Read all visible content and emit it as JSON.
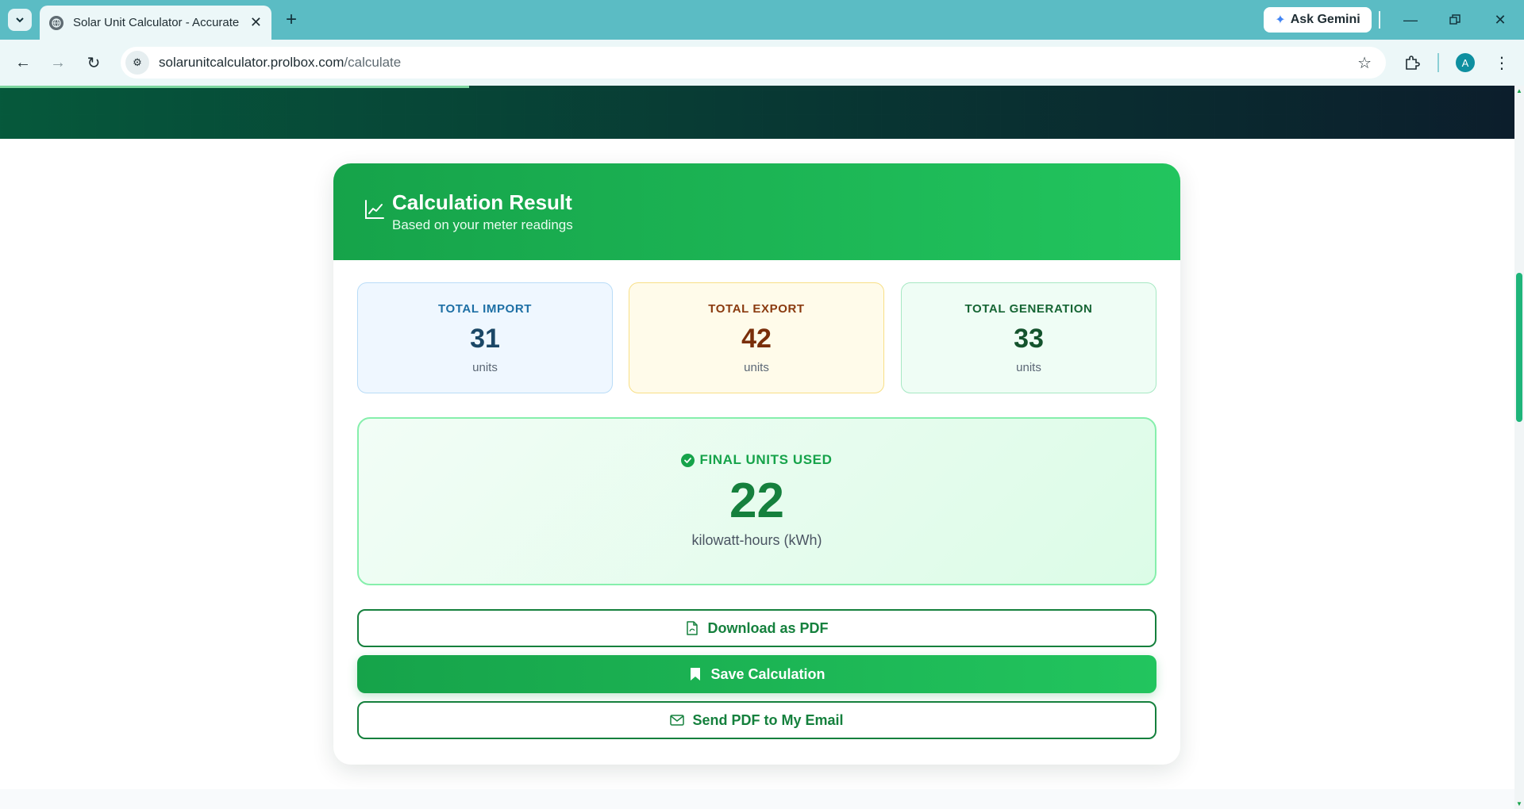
{
  "browser": {
    "tab_title": "Solar Unit Calculator - Accurate",
    "ask_gemini": "Ask Gemini",
    "url_host": "solarunitcalculator.prolbox.com",
    "url_path": "/calculate",
    "profile_initial": "A"
  },
  "page": {
    "load_progress": 0.31
  },
  "result": {
    "title": "Calculation Result",
    "subtitle": "Based on your meter readings",
    "stats": {
      "import": {
        "label": "TOTAL IMPORT",
        "value": "31",
        "unit": "units"
      },
      "export": {
        "label": "TOTAL EXPORT",
        "value": "42",
        "unit": "units"
      },
      "generation": {
        "label": "TOTAL GENERATION",
        "value": "33",
        "unit": "units"
      }
    },
    "final": {
      "label": "FINAL UNITS USED",
      "value": "22",
      "unit": "kilowatt-hours (kWh)"
    },
    "actions": {
      "download_pdf": "Download as PDF",
      "save": "Save Calculation",
      "email_pdf": "Send PDF to My Email"
    }
  },
  "colors": {
    "accent": "#16a34a",
    "browser_frame": "#5bbcc4"
  }
}
